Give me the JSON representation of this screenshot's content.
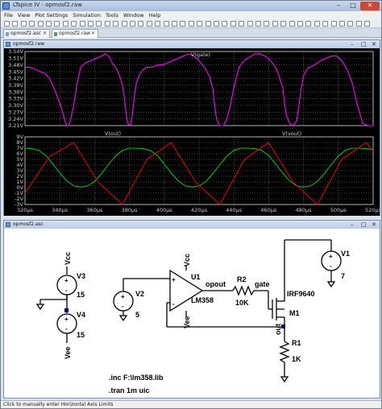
{
  "window": {
    "title": "LTspice IV - opmosf2.raw",
    "min": "–",
    "max": "□",
    "close": "✕"
  },
  "menu": [
    "File",
    "View",
    "Plot Settings",
    "Simulation",
    "Tools",
    "Window",
    "Help"
  ],
  "tabs": [
    {
      "label": "opmosf2.asc"
    },
    {
      "label": "opmosf2.raw"
    }
  ],
  "plot_window": {
    "title": "opmosf2.raw"
  },
  "schematic_window": {
    "title": "opmosf2.asc"
  },
  "status": "Click to manually enter Horizontal Axis Limits",
  "colors": {
    "gate": "#ff00ff",
    "out": "#00c000",
    "vout": "#e00000",
    "grid": "#8a8a8a",
    "plot_bg": "#000000"
  },
  "chart_data": [
    {
      "type": "line",
      "series": [
        {
          "name": "V(gate)",
          "x": [
            320,
            323,
            326,
            329,
            332,
            334,
            336,
            338,
            340,
            342,
            343,
            344,
            345,
            346,
            348,
            350,
            352,
            355,
            358,
            361,
            364,
            366,
            368,
            369,
            370,
            372,
            374,
            376,
            377,
            378,
            379,
            380,
            381,
            382,
            383,
            384,
            386,
            388,
            390,
            393,
            396,
            399,
            402,
            405,
            408,
            411,
            414,
            417,
            420,
            423,
            426,
            428,
            429,
            430,
            432,
            434,
            436,
            438,
            440,
            442,
            443,
            444,
            445,
            446,
            448,
            450,
            452,
            455,
            458,
            461,
            464,
            466,
            468,
            469,
            470,
            472,
            474,
            476,
            477,
            478,
            479,
            480,
            481,
            482,
            483,
            484,
            486,
            488,
            490,
            493,
            496,
            499,
            502,
            505,
            508,
            511,
            514,
            517,
            520
          ],
          "y": [
            3.47,
            3.47,
            3.46,
            3.45,
            3.44,
            3.42,
            3.39,
            3.35,
            3.31,
            3.26,
            3.23,
            3.21,
            3.21,
            3.23,
            3.3,
            3.4,
            3.47,
            3.49,
            3.5,
            3.51,
            3.52,
            3.53,
            3.52,
            3.51,
            3.49,
            3.47,
            3.44,
            3.39,
            3.34,
            3.27,
            3.22,
            3.21,
            3.22,
            3.28,
            3.35,
            3.4,
            3.44,
            3.46,
            3.47,
            3.47,
            3.48,
            3.48,
            3.49,
            3.5,
            3.51,
            3.52,
            3.53,
            3.52,
            3.5,
            3.47,
            3.43,
            3.37,
            3.3,
            3.24,
            3.21,
            3.21,
            3.24,
            3.3,
            3.38,
            3.44,
            3.47,
            3.48,
            3.49,
            3.5,
            3.51,
            3.52,
            3.53,
            3.53,
            3.52,
            3.5,
            3.47,
            3.43,
            3.38,
            3.32,
            3.26,
            3.22,
            3.21,
            3.23,
            3.28,
            3.34,
            3.39,
            3.43,
            3.45,
            3.46,
            3.47,
            3.47,
            3.48,
            3.49,
            3.5,
            3.51,
            3.52,
            3.52,
            3.5,
            3.46,
            3.4,
            3.3,
            3.22,
            3.21,
            3.21
          ]
        }
      ],
      "title": "V(gate)",
      "xlim": [
        320,
        520
      ],
      "ylim": [
        3.21,
        3.54
      ],
      "y_ticks": [
        "3.54V",
        "3.51V",
        "3.48V",
        "3.45V",
        "3.42V",
        "3.39V",
        "3.36V",
        "3.33V",
        "3.30V",
        "3.27V",
        "3.24V",
        "3.21V"
      ],
      "y_tick_values": [
        3.54,
        3.51,
        3.48,
        3.45,
        3.42,
        3.39,
        3.36,
        3.33,
        3.3,
        3.27,
        3.24,
        3.21
      ],
      "grid": true
    },
    {
      "type": "line",
      "series": [
        {
          "name": "V(out)",
          "x": [
            320,
            324,
            328,
            332,
            336,
            340,
            344,
            348,
            352,
            356,
            360,
            364,
            368,
            372,
            376,
            380,
            384,
            388,
            392,
            396,
            400,
            404,
            408,
            412,
            416,
            420,
            424,
            428,
            432,
            436,
            440,
            444,
            448,
            452,
            456,
            460,
            464,
            468,
            472,
            476,
            480,
            484,
            488,
            492,
            496,
            500,
            504,
            508,
            512,
            516,
            520
          ],
          "y": [
            7,
            6.9,
            6.6,
            5.7,
            4.2,
            2.6,
            1.2,
            0.3,
            0.1,
            0.3,
            1.1,
            2.5,
            4.1,
            5.6,
            6.6,
            7,
            7,
            6.9,
            6.6,
            5.7,
            4.2,
            2.6,
            1.2,
            0.3,
            0.1,
            0.3,
            1.1,
            2.5,
            4.1,
            5.6,
            6.6,
            7,
            7,
            6.9,
            6.6,
            5.7,
            4.2,
            2.6,
            1.2,
            0.3,
            0.1,
            0.3,
            1.1,
            2.5,
            4.1,
            5.6,
            6.6,
            7,
            7,
            6.9,
            6.7
          ]
        },
        {
          "name": "V(vout)",
          "x": [
            320,
            334,
            348,
            362,
            376,
            390,
            404,
            418,
            432,
            446,
            460,
            474,
            488,
            502,
            516,
            520
          ],
          "y": [
            -1,
            5.5,
            8,
            1,
            -3,
            5,
            8,
            1,
            -3,
            5,
            8,
            1,
            -3,
            5,
            8,
            6.5
          ]
        }
      ],
      "xlim": [
        320,
        520
      ],
      "ylim": [
        -3,
        9
      ],
      "x_ticks": [
        "320µs",
        "340µs",
        "360µs",
        "380µs",
        "400µs",
        "420µs",
        "440µs",
        "460µs",
        "480µs",
        "500µs",
        "520µs"
      ],
      "x_tick_values": [
        320,
        340,
        360,
        380,
        400,
        420,
        440,
        460,
        480,
        500,
        520
      ],
      "y_ticks": [
        "9V",
        "8V",
        "7V",
        "6V",
        "5V",
        "4V",
        "3V",
        "2V",
        "1V",
        "0V",
        "-1V",
        "-2V",
        "-3V"
      ],
      "y_tick_values": [
        9,
        8,
        7,
        6,
        5,
        4,
        3,
        2,
        1,
        0,
        -1,
        -2,
        -3
      ],
      "grid": true
    }
  ],
  "schematic": {
    "labels": {
      "vcc_net": "Vcc",
      "vee_net": "Vee",
      "v3": "V3",
      "v3_val": "15",
      "v4": "V4",
      "v4_val": "15",
      "v2": "V2",
      "v2_val": "5",
      "u1": "U1",
      "u1_model": "LM358",
      "u1_vcc": "Vcc",
      "u1_vee": "Vee",
      "opout": "opout",
      "r2": "R2",
      "r2_val": "10K",
      "gate": "gate",
      "m1_model": "IRF9640",
      "m1": "M1",
      "out": "out",
      "r1": "R1",
      "r1_val": "1K",
      "v1": "V1",
      "v1_val": "7",
      "plus": "+",
      "minus": "-"
    },
    "directives": [
      ".inc F:\\lm358.lib",
      ".tran 1m uic"
    ]
  }
}
